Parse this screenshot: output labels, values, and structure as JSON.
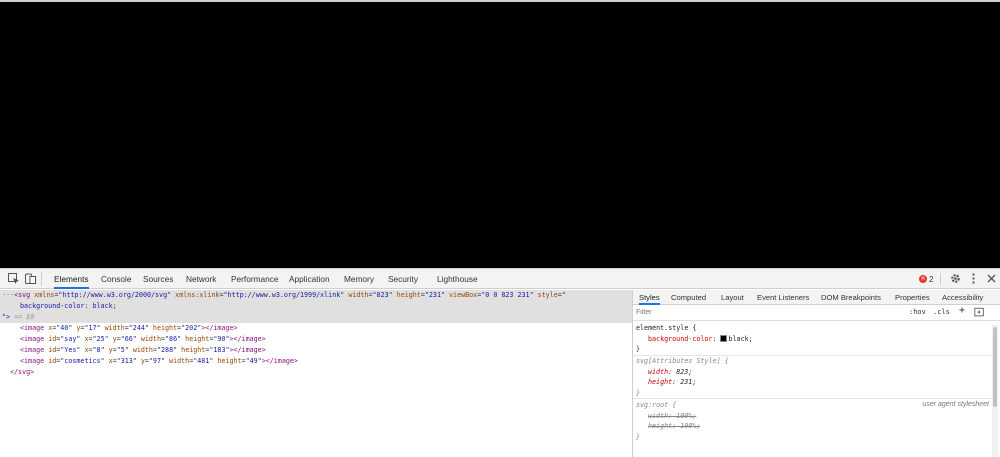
{
  "stage": {
    "background": "#000000"
  },
  "toolbar": {
    "tabs": [
      {
        "label": "Elements",
        "active": true
      },
      {
        "label": "Console"
      },
      {
        "label": "Sources"
      },
      {
        "label": "Network"
      },
      {
        "label": "Performance"
      },
      {
        "label": "Application"
      },
      {
        "label": "Memory"
      },
      {
        "label": "Security"
      },
      {
        "label": "Lighthouse"
      }
    ],
    "error_count": "2",
    "icons": [
      "inspect-icon",
      "device-toggle-icon",
      "error-icon",
      "gear-icon",
      "kebab-menu-icon",
      "close-icon"
    ]
  },
  "elements": {
    "svg_open": {
      "ellipsis": "···",
      "tag": "<svg",
      "attrs": [
        {
          "name": "xmlns",
          "value": "\"http://www.w3.org/2000/svg\""
        },
        {
          "name": "xmlns:xlink",
          "value": "\"http://www.w3.org/1999/xlink\""
        },
        {
          "name": "width",
          "value": "\"823\""
        },
        {
          "name": "height",
          "value": "\"231\""
        },
        {
          "name": "viewBox",
          "value": "\"0 0 823 231\""
        },
        {
          "name": "style",
          "value": "\""
        }
      ],
      "style_cont": "background-color: black;",
      "close": "\">",
      "eq0": "== $0"
    },
    "images": [
      {
        "line": [
          [
            "tag",
            "<image "
          ],
          [
            "an",
            "x"
          ],
          [
            "eq",
            "="
          ],
          [
            "av",
            "\"40\""
          ],
          [
            "an",
            " y"
          ],
          [
            "eq",
            "="
          ],
          [
            "av",
            "\"17\""
          ],
          [
            "an",
            " width"
          ],
          [
            "eq",
            "="
          ],
          [
            "av",
            "\"244\""
          ],
          [
            "an",
            " height"
          ],
          [
            "eq",
            "="
          ],
          [
            "av",
            "\"202\""
          ],
          [
            "tag",
            "></image>"
          ]
        ]
      },
      {
        "line": [
          [
            "tag",
            "<image "
          ],
          [
            "an",
            "id"
          ],
          [
            "eq",
            "="
          ],
          [
            "av",
            "\"say\""
          ],
          [
            "an",
            " x"
          ],
          [
            "eq",
            "="
          ],
          [
            "av",
            "\"25\""
          ],
          [
            "an",
            " y"
          ],
          [
            "eq",
            "="
          ],
          [
            "av",
            "\"66\""
          ],
          [
            "an",
            " width"
          ],
          [
            "eq",
            "="
          ],
          [
            "av",
            "\"86\""
          ],
          [
            "an",
            " height"
          ],
          [
            "eq",
            "="
          ],
          [
            "av",
            "\"90\""
          ],
          [
            "tag",
            "></image>"
          ]
        ]
      },
      {
        "line": [
          [
            "tag",
            "<image "
          ],
          [
            "an",
            "id"
          ],
          [
            "eq",
            "="
          ],
          [
            "av",
            "\"Yes\""
          ],
          [
            "an",
            " x"
          ],
          [
            "eq",
            "="
          ],
          [
            "av",
            "\"8\""
          ],
          [
            "an",
            " y"
          ],
          [
            "eq",
            "="
          ],
          [
            "av",
            "\"5\""
          ],
          [
            "an",
            " width"
          ],
          [
            "eq",
            "="
          ],
          [
            "av",
            "\"288\""
          ],
          [
            "an",
            " height"
          ],
          [
            "eq",
            "="
          ],
          [
            "av",
            "\"183\""
          ],
          [
            "tag",
            "></image>"
          ]
        ]
      },
      {
        "line": [
          [
            "tag",
            "<image "
          ],
          [
            "an",
            "id"
          ],
          [
            "eq",
            "="
          ],
          [
            "av",
            "\"cosmetics\""
          ],
          [
            "an",
            " x"
          ],
          [
            "eq",
            "="
          ],
          [
            "av",
            "\"313\""
          ],
          [
            "an",
            " y"
          ],
          [
            "eq",
            "="
          ],
          [
            "av",
            "\"97\""
          ],
          [
            "an",
            " width"
          ],
          [
            "eq",
            "="
          ],
          [
            "av",
            "\"481\""
          ],
          [
            "an",
            " height"
          ],
          [
            "eq",
            "="
          ],
          [
            "av",
            "\"49\""
          ],
          [
            "tag",
            "></image>"
          ]
        ]
      }
    ],
    "svg_close": "</svg>"
  },
  "styles_pane": {
    "tabs": [
      {
        "label": "Styles",
        "active": true
      },
      {
        "label": "Computed"
      },
      {
        "label": "Layout"
      },
      {
        "label": "Event Listeners"
      },
      {
        "label": "DOM Breakpoints"
      },
      {
        "label": "Properties"
      },
      {
        "label": "Accessibility"
      }
    ],
    "filter_placeholder": "Filter",
    "hov": ":hov",
    "cls": ".cls",
    "plus": "+",
    "rules": {
      "element_style": {
        "selector": "element.style {",
        "prop": "background-color",
        "value": "black;",
        "close": "}"
      },
      "attr_style": {
        "selector": "svg[Attributes Style] {",
        "props": [
          {
            "prop": "width",
            "value": "823;"
          },
          {
            "prop": "height",
            "value": "231;"
          }
        ],
        "close": "}"
      },
      "root": {
        "selector": "svg:root {",
        "source": "user agent stylesheet",
        "props": [
          {
            "text": "width: 100%;"
          },
          {
            "text": "height: 100%;"
          }
        ],
        "close": "}"
      }
    }
  }
}
